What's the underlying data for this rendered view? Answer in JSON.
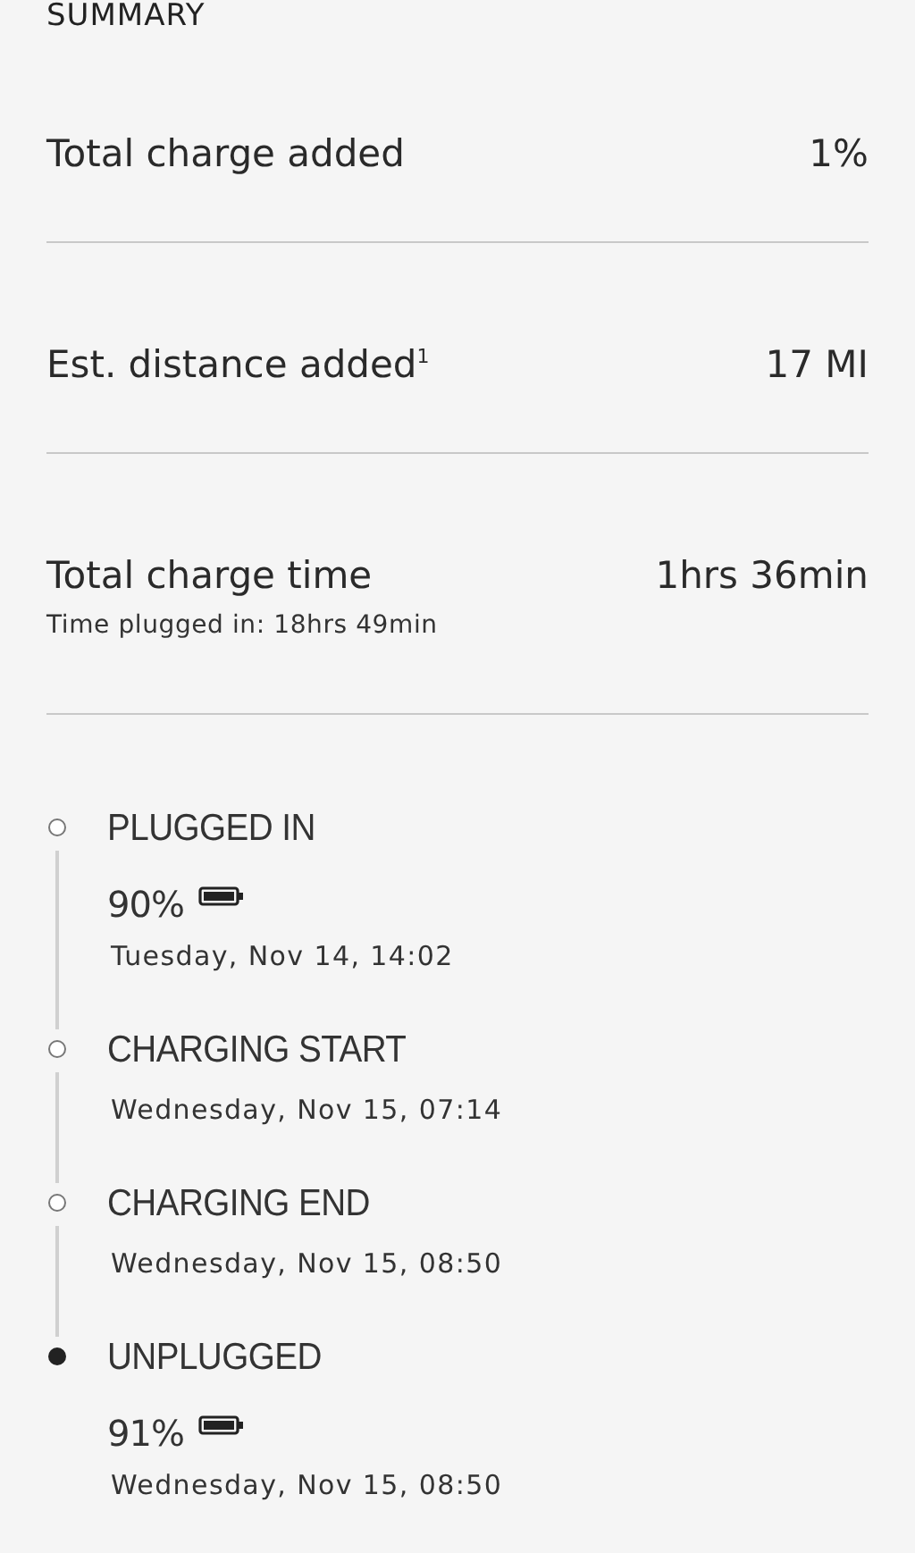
{
  "section_title": "SUMMARY",
  "summary": [
    {
      "label": "Total charge added",
      "value": "1%"
    },
    {
      "label": "Est. distance added$^{1}$",
      "value": "17 MI"
    },
    {
      "label": "Total charge time",
      "value": "1hrs 36min",
      "detail": "Time plugged in: 18hrs 49min"
    }
  ],
  "timeline": [
    {
      "title": "PLUGGED IN",
      "battery": "90%",
      "date": "Tuesday, Nov 14, 14:02",
      "current": false
    },
    {
      "title": "CHARGING START",
      "date": "Wednesday, Nov 15, 07:14",
      "current": false
    },
    {
      "title": "CHARGING END",
      "date": "Wednesday, Nov 15, 08:50",
      "current": false
    },
    {
      "title": "UNPLUGGED",
      "battery": "91%",
      "date": "Wednesday, Nov 15, 08:50",
      "current": true
    }
  ]
}
